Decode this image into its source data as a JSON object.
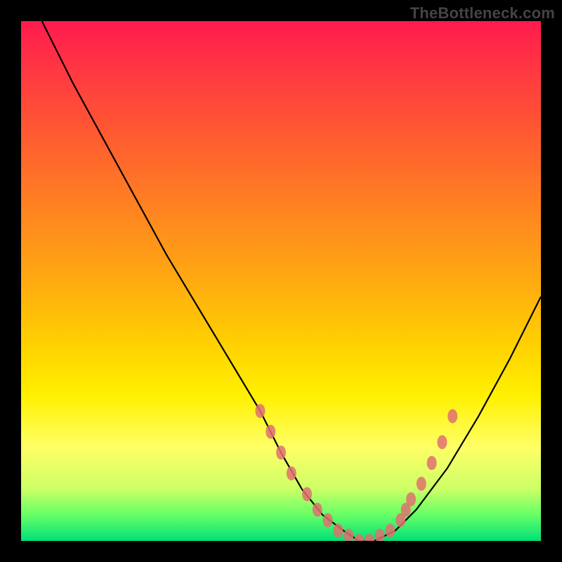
{
  "watermark": "TheBottleneck.com",
  "chart_data": {
    "type": "line",
    "title": "",
    "xlabel": "",
    "ylabel": "",
    "xlim": [
      0,
      100
    ],
    "ylim": [
      0,
      100
    ],
    "series": [
      {
        "name": "bottleneck-curve",
        "x": [
          4,
          10,
          16,
          22,
          28,
          34,
          40,
          46,
          50,
          54,
          58,
          62,
          65,
          68,
          72,
          76,
          82,
          88,
          94,
          100
        ],
        "values": [
          100,
          88,
          77,
          66,
          55,
          45,
          35,
          25,
          17,
          10,
          5,
          2,
          0,
          0,
          2,
          6,
          14,
          24,
          35,
          47
        ]
      }
    ],
    "highlight_dots": {
      "name": "highlighted-range",
      "color": "#e07070",
      "points": [
        {
          "x": 46,
          "y": 25
        },
        {
          "x": 48,
          "y": 21
        },
        {
          "x": 50,
          "y": 17
        },
        {
          "x": 52,
          "y": 13
        },
        {
          "x": 55,
          "y": 9
        },
        {
          "x": 57,
          "y": 6
        },
        {
          "x": 59,
          "y": 4
        },
        {
          "x": 61,
          "y": 2
        },
        {
          "x": 63,
          "y": 1
        },
        {
          "x": 65,
          "y": 0
        },
        {
          "x": 67,
          "y": 0
        },
        {
          "x": 69,
          "y": 1
        },
        {
          "x": 71,
          "y": 2
        },
        {
          "x": 73,
          "y": 4
        },
        {
          "x": 74,
          "y": 6
        },
        {
          "x": 75,
          "y": 8
        },
        {
          "x": 77,
          "y": 11
        },
        {
          "x": 79,
          "y": 15
        },
        {
          "x": 81,
          "y": 19
        },
        {
          "x": 83,
          "y": 24
        }
      ]
    }
  }
}
